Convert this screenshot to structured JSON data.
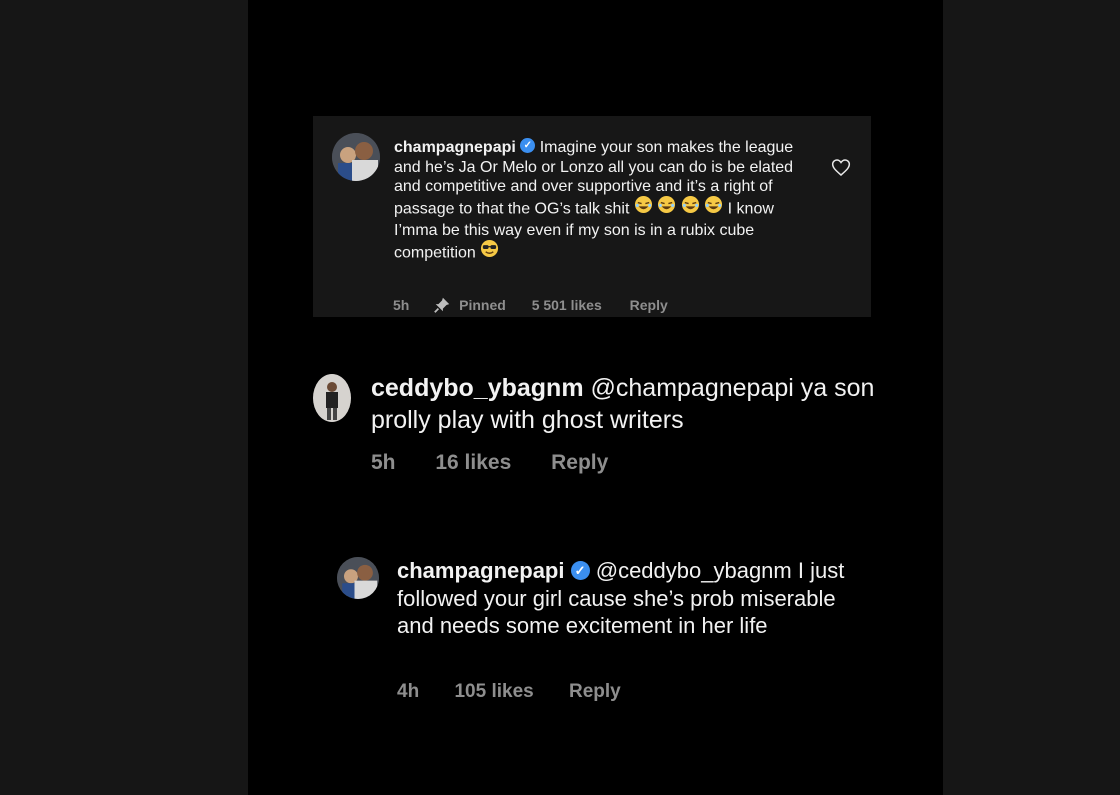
{
  "comments": [
    {
      "username": "champagnepapi",
      "verified": true,
      "text_1": "Imagine your son makes the league and he’s Ja Or Melo or Lonzo all you can do is be elated and competitive and over supportive and it’s a right of passage to that the OG’s talk shit",
      "text_2": "I know I’mma be this way even if my son is in a rubix cube competition",
      "time": "5h",
      "pinned_label": "Pinned",
      "likes": "5 501 likes",
      "reply_label": "Reply"
    },
    {
      "username": "ceddybo_ybagnm",
      "text": "@champagnepapi ya son prolly play with ghost writers",
      "time": "5h",
      "likes": "16 likes",
      "reply_label": "Reply"
    },
    {
      "username": "champagnepapi",
      "verified": true,
      "text": "@ceddybo_ybagnm I just followed your girl cause she’s prob miserable and needs some excitement in her life",
      "time": "4h",
      "likes": "105 likes",
      "reply_label": "Reply"
    }
  ],
  "colors": {
    "background": "#000000",
    "pinned_background": "#171717",
    "text": "#f2f2f2",
    "meta": "#8e8e8e",
    "verified": "#3b8ff0"
  },
  "icons": [
    "verified-badge-icon",
    "pin-icon",
    "heart-icon",
    "laughing-emoji-icon",
    "sunglasses-emoji-icon"
  ]
}
